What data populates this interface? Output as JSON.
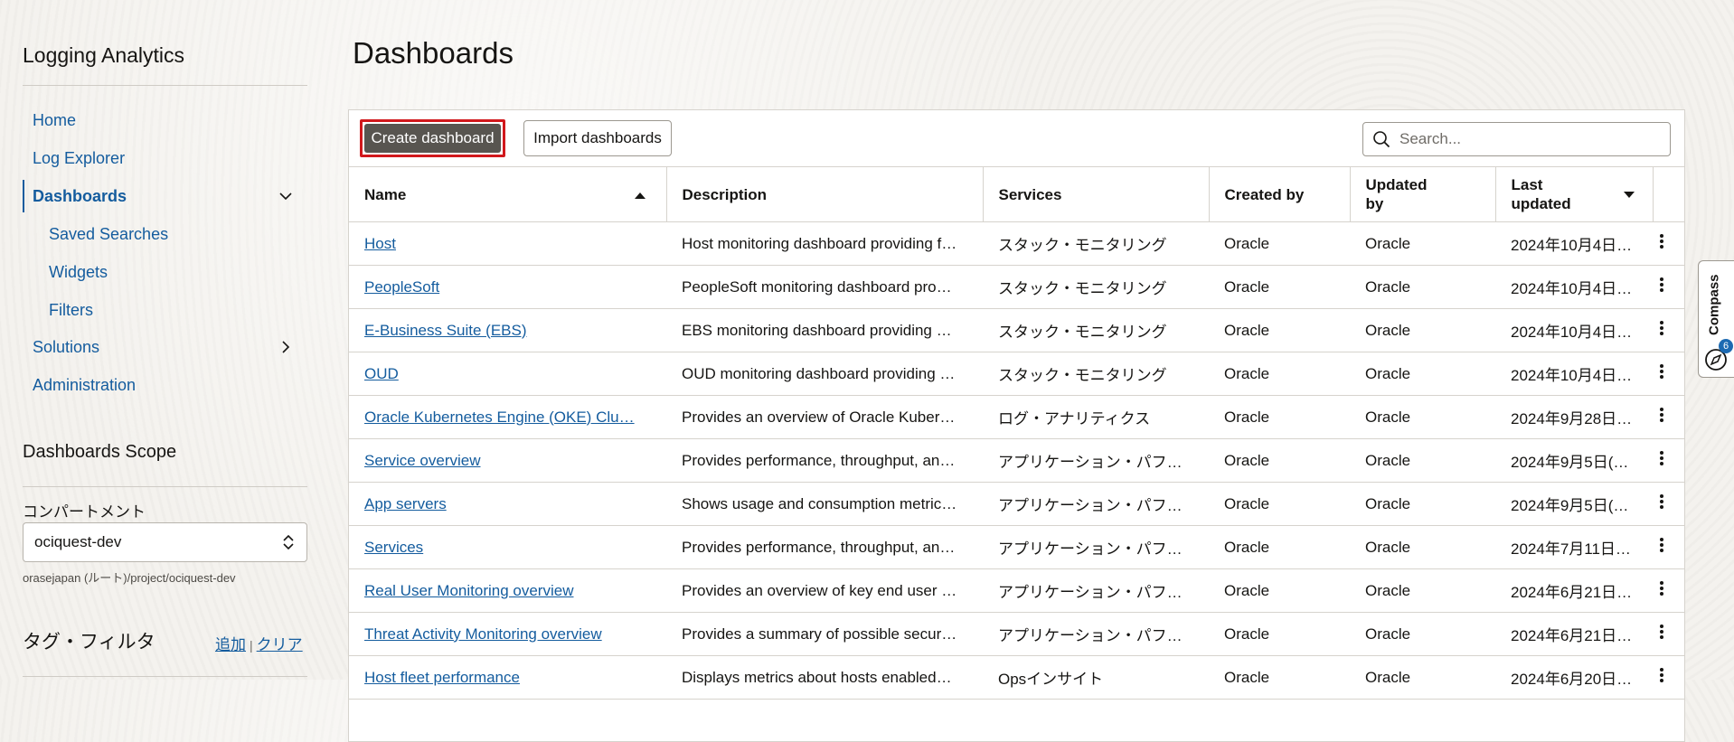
{
  "sidebar": {
    "app_title": "Logging Analytics",
    "nav": [
      {
        "label": "Home"
      },
      {
        "label": "Log Explorer"
      },
      {
        "label": "Dashboards"
      },
      {
        "label": "Saved Searches"
      },
      {
        "label": "Widgets"
      },
      {
        "label": "Filters"
      },
      {
        "label": "Solutions"
      },
      {
        "label": "Administration"
      }
    ],
    "scope_title": "Dashboards Scope",
    "compartment_label": "コンパートメント",
    "compartment_value": "ociquest-dev",
    "compartment_path": "orasejapan (ルート)/project/ociquest-dev",
    "tag_filter_title": "タグ・フィルタ",
    "tag_add": "追加",
    "tag_sep": "|",
    "tag_clear": "クリア"
  },
  "main": {
    "title": "Dashboards",
    "create_button": "Create dashboard",
    "import_button": "Import dashboards",
    "search_placeholder": "Search...",
    "columns": {
      "name": "Name",
      "description": "Description",
      "services": "Services",
      "created_by": "Created by",
      "updated_by": "Updated by",
      "last_updated": "Last updated"
    },
    "rows": [
      {
        "name": "Host",
        "description": "Host monitoring dashboard providing f…",
        "services": "スタック・モニタリング",
        "created_by": "Oracle",
        "updated_by": "Oracle",
        "last_updated": "2024年10月4日…"
      },
      {
        "name": "PeopleSoft",
        "description": "PeopleSoft monitoring dashboard pro…",
        "services": "スタック・モニタリング",
        "created_by": "Oracle",
        "updated_by": "Oracle",
        "last_updated": "2024年10月4日…"
      },
      {
        "name": "E-Business Suite (EBS)",
        "description": "EBS monitoring dashboard providing …",
        "services": "スタック・モニタリング",
        "created_by": "Oracle",
        "updated_by": "Oracle",
        "last_updated": "2024年10月4日…"
      },
      {
        "name": "OUD",
        "description": "OUD monitoring dashboard providing …",
        "services": "スタック・モニタリング",
        "created_by": "Oracle",
        "updated_by": "Oracle",
        "last_updated": "2024年10月4日…"
      },
      {
        "name": "Oracle Kubernetes Engine (OKE) Clu…",
        "description": "Provides an overview of Oracle Kuber…",
        "services": "ログ・アナリティクス",
        "created_by": "Oracle",
        "updated_by": "Oracle",
        "last_updated": "2024年9月28日…"
      },
      {
        "name": "Service overview",
        "description": "Provides performance, throughput, an…",
        "services": "アプリケーション・パフ…",
        "created_by": "Oracle",
        "updated_by": "Oracle",
        "last_updated": "2024年9月5日(…"
      },
      {
        "name": "App servers",
        "description": "Shows usage and consumption metric…",
        "services": "アプリケーション・パフ…",
        "created_by": "Oracle",
        "updated_by": "Oracle",
        "last_updated": "2024年9月5日(…"
      },
      {
        "name": "Services",
        "description": "Provides performance, throughput, an…",
        "services": "アプリケーション・パフ…",
        "created_by": "Oracle",
        "updated_by": "Oracle",
        "last_updated": "2024年7月11日…"
      },
      {
        "name": "Real User Monitoring overview",
        "description": "Provides an overview of key end user …",
        "services": "アプリケーション・パフ…",
        "created_by": "Oracle",
        "updated_by": "Oracle",
        "last_updated": "2024年6月21日…"
      },
      {
        "name": "Threat Activity Monitoring overview",
        "description": "Provides a summary of possible secur…",
        "services": "アプリケーション・パフ…",
        "created_by": "Oracle",
        "updated_by": "Oracle",
        "last_updated": "2024年6月21日…"
      },
      {
        "name": "Host fleet performance",
        "description": "Displays metrics about hosts enabled…",
        "services": "Opsインサイト",
        "created_by": "Oracle",
        "updated_by": "Oracle",
        "last_updated": "2024年6月20日…"
      }
    ]
  },
  "compass": {
    "label": "Compass",
    "badge": "6"
  }
}
